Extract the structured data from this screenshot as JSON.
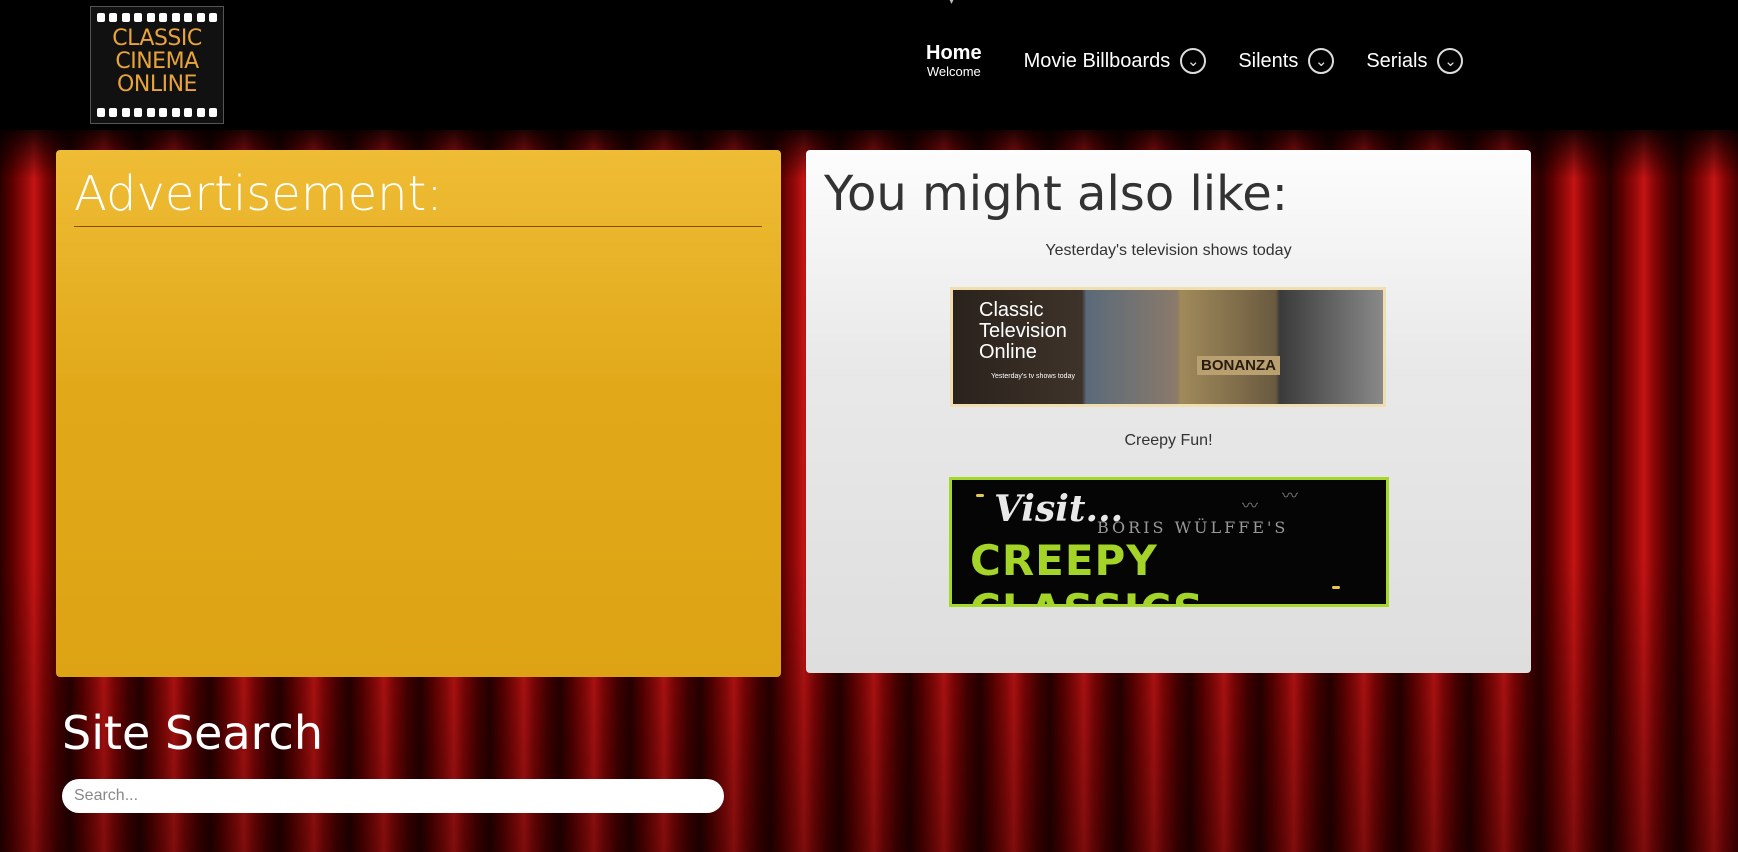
{
  "logo": {
    "lines": [
      "CLASSIC",
      "CINEMA",
      "ONLINE"
    ]
  },
  "nav": {
    "home": {
      "label": "Home",
      "sublabel": "Welcome"
    },
    "items": [
      {
        "label": "Movie Billboards",
        "icon": "chevron-down-icon"
      },
      {
        "label": "Silents",
        "icon": "chevron-down-icon"
      },
      {
        "label": "Serials",
        "icon": "chevron-down-icon"
      }
    ]
  },
  "ad_panel": {
    "title": "Advertisement:"
  },
  "like_panel": {
    "title": "You might also like:",
    "items": [
      {
        "caption": "Yesterday's television shows today",
        "banner": {
          "title_lines": [
            "Classic",
            "Television",
            "Online"
          ],
          "tagline": "Yesterday's tv shows today",
          "inset_text": "BONANZA"
        }
      },
      {
        "caption": "Creepy Fun!",
        "banner": {
          "visit": "Visit...",
          "byline": "BORIS WÜLFFE'S",
          "title": "CREEPY CLASSICS"
        }
      }
    ]
  },
  "search": {
    "title": "Site Search",
    "placeholder": "Search..."
  },
  "colors": {
    "ad_panel": "#e1a91a",
    "curtain": "#c41414",
    "creepy_green": "#a4d428",
    "logo_gold": "#e8a33a"
  }
}
